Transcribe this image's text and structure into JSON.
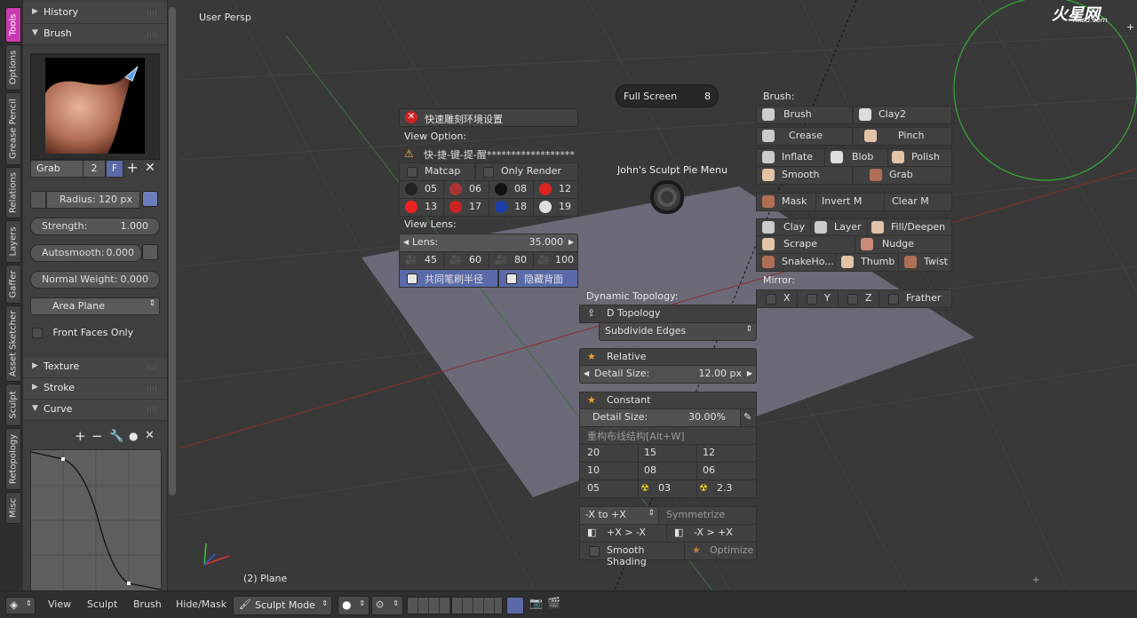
{
  "vertical_tabs": [
    "Tools",
    "Options",
    "Grease Pencil",
    "Relations",
    "Layers",
    "Gaffer",
    "Asset Sketcher",
    "Sculpt",
    "Retopology",
    "Misc"
  ],
  "tool_panel": {
    "history_label": "History",
    "brush_label": "Brush",
    "brush_name": "Grab",
    "brush_users": "2",
    "brush_fake": "F",
    "radius": {
      "label": "Radius:",
      "value": "120 px"
    },
    "strength": {
      "label": "Strength:",
      "value": "1.000"
    },
    "autosmooth": {
      "label": "Autosmooth:",
      "value": "0.000"
    },
    "normal_weight": {
      "label": "Normal Weight:",
      "value": "0.000"
    },
    "area_plane": "Area Plane",
    "front_faces_only": "Front Faces Only",
    "texture_label": "Texture",
    "stroke_label": "Stroke",
    "curve_label": "Curve"
  },
  "viewport": {
    "view_label": "User Persp",
    "object_label": "(2) Plane",
    "watermark": "火星网",
    "watermark_url": "hxsd.com"
  },
  "env_panel": {
    "title": "快速雕刻环境设置",
    "view_option_label": "View Option:",
    "shortcut_text": "快-捷-键-提-醒**********************",
    "matcap": "Matcap",
    "only_render": "Only Render",
    "matcaps": [
      "05",
      "06",
      "08",
      "12",
      "13",
      "17",
      "18",
      "19"
    ],
    "view_lens_label": "View Lens:",
    "lens_label": "Lens:",
    "lens_value": "35.000",
    "lens_presets": [
      "45",
      "60",
      "80",
      "100"
    ],
    "same_brush_radius": "共同笔刷半径",
    "hide_backface": "隐藏背面"
  },
  "fullscreen": {
    "label": "Full Screen",
    "key": "8"
  },
  "pie_menu_title": "John's Sculpt Pie Menu",
  "brush_panel": {
    "label": "Brush:",
    "rows": [
      [
        "Brush",
        "Clay2"
      ],
      [
        "Crease",
        "Pinch"
      ],
      [
        "Inflate",
        "Blob",
        "Polish"
      ],
      [
        "Smooth",
        "Grab"
      ]
    ],
    "mask_row": [
      "Mask",
      "Invert M",
      "Clear M"
    ],
    "rows2": [
      [
        "Clay",
        "Layer",
        "Fill/Deepen"
      ],
      [
        "Scrape",
        "Nudge"
      ],
      [
        "SnakeHo...",
        "Thumb",
        "Twist"
      ]
    ],
    "mirror_label": "Mirror:",
    "mirror": [
      "X",
      "Y",
      "Z",
      "Frather"
    ]
  },
  "dyntopo_panel": {
    "label": "Dynamic Topology:",
    "d_topology": "D Topology",
    "subdivide": "Subdivide Edges",
    "relative": "Relative",
    "detail_size_label": "Detail Size:",
    "detail_size_value": "12.00 px",
    "constant": "Constant",
    "constant_detail_label": "Detail Size:",
    "constant_detail_value": "30.00%",
    "rebuild_label": "重构布线结构[Alt+W]",
    "grid": [
      [
        "20",
        "15",
        "12"
      ],
      [
        "10",
        "08",
        "06"
      ],
      [
        "05",
        "03",
        "2.3"
      ]
    ],
    "sym_dir": "-X to +X",
    "symmetrize": "Symmetrize",
    "px_to_nx": "+X > -X",
    "nx_to_px": "-X > +X",
    "smooth_shading": "Smooth Shading",
    "optimize": "Optimize"
  },
  "statusbar": {
    "menus": [
      "View",
      "Sculpt",
      "Brush",
      "Hide/Mask"
    ],
    "mode": "Sculpt Mode"
  },
  "colors": {
    "accent": "#c83bb0",
    "selection": "#5a6aa8",
    "floor": "#6e6a7a"
  }
}
